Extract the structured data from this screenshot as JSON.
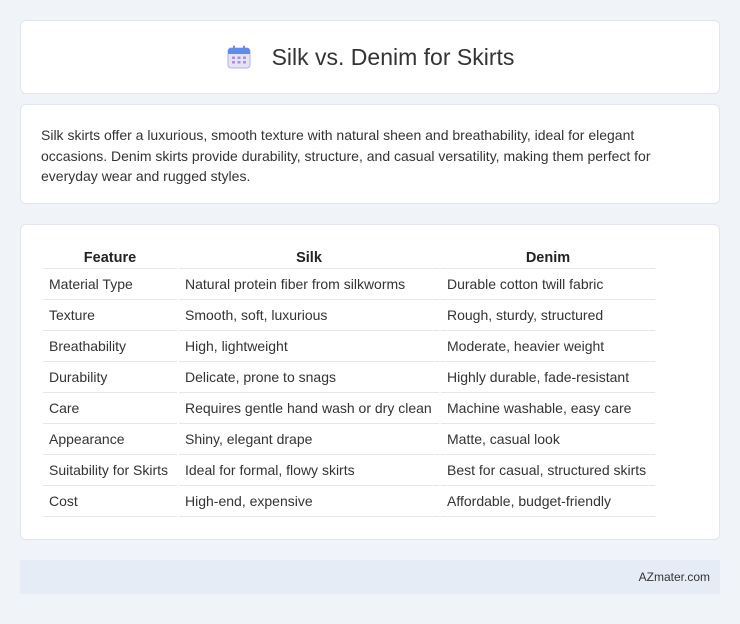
{
  "header": {
    "title": "Silk vs. Denim for Skirts",
    "icon": "calendar-icon"
  },
  "summary": {
    "text": "Silk skirts offer a luxurious, smooth texture with natural sheen and breathability, ideal for elegant occasions. Denim skirts provide durability, structure, and casual versatility, making them perfect for everyday wear and rugged styles."
  },
  "table": {
    "headers": [
      "Feature",
      "Silk",
      "Denim"
    ],
    "rows": [
      [
        "Material Type",
        "Natural protein fiber from silkworms",
        "Durable cotton twill fabric"
      ],
      [
        "Texture",
        "Smooth, soft, luxurious",
        "Rough, sturdy, structured"
      ],
      [
        "Breathability",
        "High, lightweight",
        "Moderate, heavier weight"
      ],
      [
        "Durability",
        "Delicate, prone to snags",
        "Highly durable, fade-resistant"
      ],
      [
        "Care",
        "Requires gentle hand wash or dry clean",
        "Machine washable, easy care"
      ],
      [
        "Appearance",
        "Shiny, elegant drape",
        "Matte, casual look"
      ],
      [
        "Suitability for Skirts",
        "Ideal for formal, flowy skirts",
        "Best for casual, structured skirts"
      ],
      [
        "Cost",
        "High-end, expensive",
        "Affordable, budget-friendly"
      ]
    ]
  },
  "footer": {
    "text": "AZmater.com"
  }
}
